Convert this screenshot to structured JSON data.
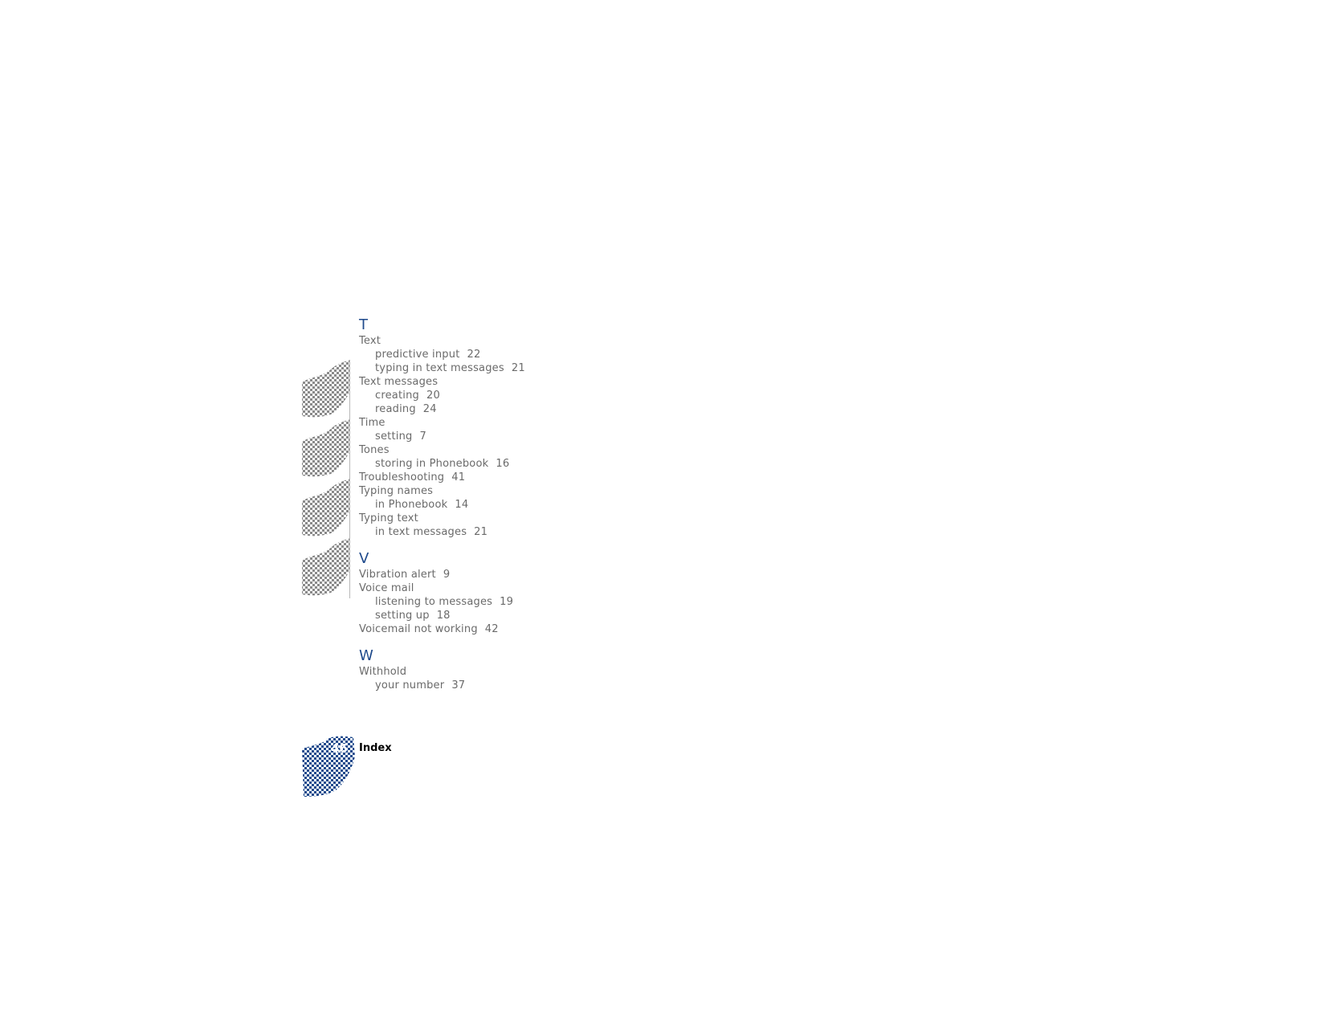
{
  "colors": {
    "letter_heading": "#1f4a8c",
    "entry_text": "#6a6a6a",
    "badge_fill": "#1f4a8c",
    "halftone": "#8a8a8a"
  },
  "index": {
    "sections": [
      {
        "letter": "T",
        "entries": [
          {
            "term": "Text",
            "page": ""
          },
          {
            "term": "predictive input",
            "page": "22",
            "sub": true
          },
          {
            "term": "typing in text messages",
            "page": "21",
            "sub": true
          },
          {
            "term": "Text messages",
            "page": ""
          },
          {
            "term": "creating",
            "page": "20",
            "sub": true
          },
          {
            "term": "reading",
            "page": "24",
            "sub": true
          },
          {
            "term": "Time",
            "page": ""
          },
          {
            "term": "setting",
            "page": "7",
            "sub": true
          },
          {
            "term": "Tones",
            "page": ""
          },
          {
            "term": "storing in Phonebook",
            "page": "16",
            "sub": true
          },
          {
            "term": "Troubleshooting",
            "page": "41"
          },
          {
            "term": "Typing names",
            "page": ""
          },
          {
            "term": "in Phonebook",
            "page": "14",
            "sub": true
          },
          {
            "term": "Typing text",
            "page": ""
          },
          {
            "term": "in text messages",
            "page": "21",
            "sub": true
          }
        ]
      },
      {
        "letter": "V",
        "entries": [
          {
            "term": "Vibration alert",
            "page": "9"
          },
          {
            "term": "Voice mail",
            "page": ""
          },
          {
            "term": "listening to messages",
            "page": "19",
            "sub": true
          },
          {
            "term": "setting up",
            "page": "18",
            "sub": true
          },
          {
            "term": "Voicemail not working",
            "page": "42"
          }
        ]
      },
      {
        "letter": "W",
        "entries": [
          {
            "term": "Withhold",
            "page": ""
          },
          {
            "term": "your number",
            "page": "37",
            "sub": true
          }
        ]
      }
    ]
  },
  "footer": {
    "page_number": "46",
    "section_title": "Index"
  },
  "decorations": {
    "tab_icons": [
      "halftone-tab-icon",
      "halftone-tab-icon",
      "halftone-tab-icon",
      "halftone-tab-icon"
    ],
    "badge_icon": "halftone-page-badge-icon"
  }
}
